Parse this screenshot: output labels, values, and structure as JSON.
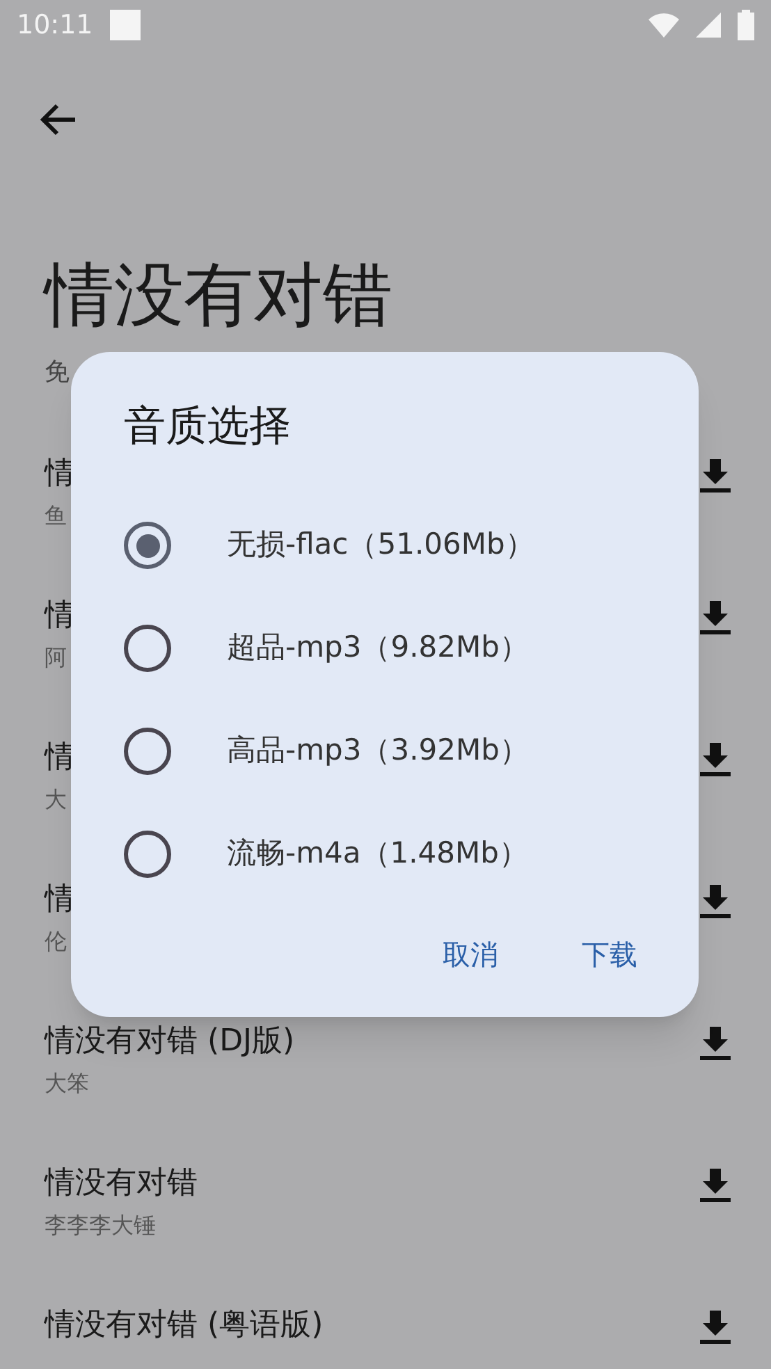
{
  "status_bar": {
    "time": "10:11"
  },
  "header": {
    "title": "情没有对错",
    "subtitle": "免"
  },
  "songs": [
    {
      "title": "情",
      "artist": "鱼"
    },
    {
      "title": "情",
      "artist": "阿"
    },
    {
      "title": "情",
      "artist": "大"
    },
    {
      "title": "情",
      "artist": "伦"
    },
    {
      "title": "情没有对错 (DJ版)",
      "artist": "大笨"
    },
    {
      "title": "情没有对错",
      "artist": "李李李大锤"
    },
    {
      "title": "情没有对错 (粤语版)"
    }
  ],
  "dialog": {
    "title": "音质选择",
    "options": [
      {
        "label": "无损-flac（51.06Mb）",
        "selected": true
      },
      {
        "label": "超品-mp3（9.82Mb）",
        "selected": false
      },
      {
        "label": "高品-mp3（3.92Mb）",
        "selected": false
      },
      {
        "label": "流畅-m4a（1.48Mb）",
        "selected": false
      }
    ],
    "buttons": [
      "取消",
      "下载"
    ]
  }
}
